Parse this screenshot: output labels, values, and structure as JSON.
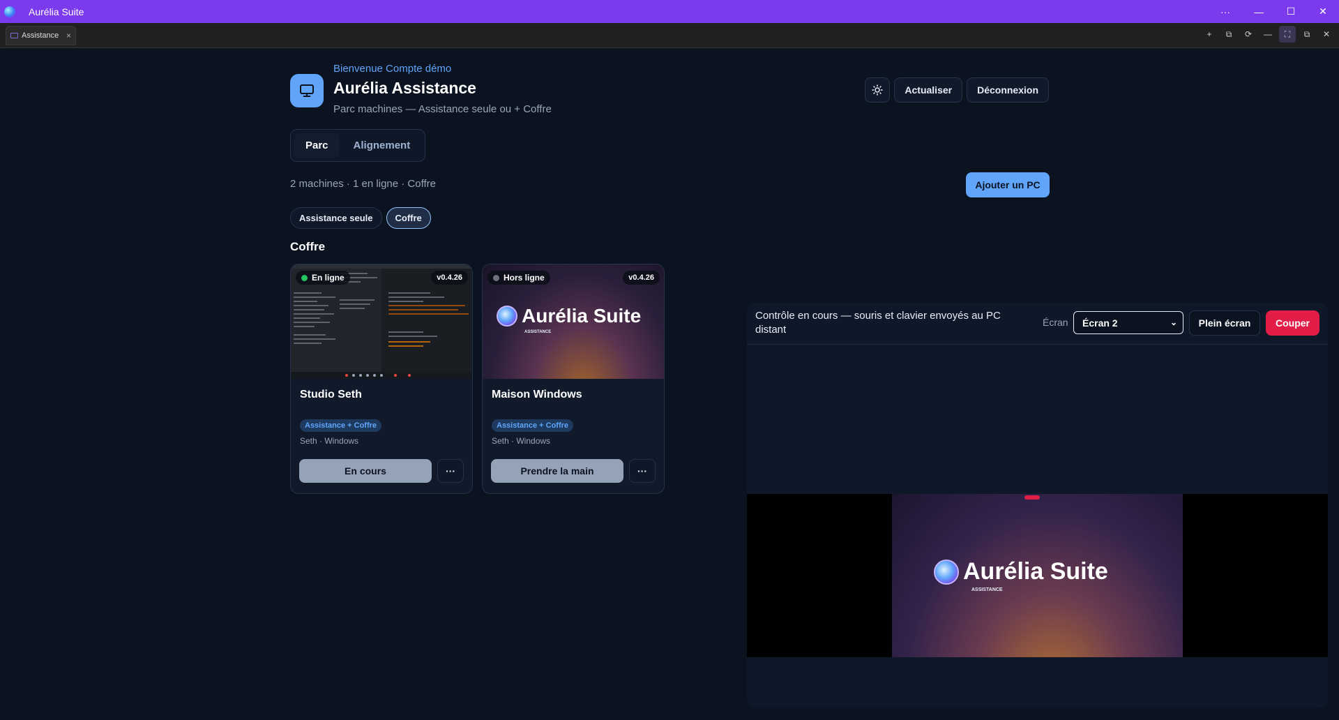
{
  "window": {
    "title": "Aurélia Suite",
    "controls": {
      "more": "···",
      "minimize": "—",
      "maximize": "☐",
      "close": "✕"
    }
  },
  "tabbar": {
    "tab_label": "Assistance",
    "tab_close": "×",
    "tools": [
      "+",
      "⧉",
      "⟳",
      "—",
      "⛶",
      "⧉",
      "✕"
    ]
  },
  "header": {
    "welcome": "Bienvenue Compte démo",
    "title": "Aurélia Assistance",
    "subtitle": "Parc machines — Assistance seule ou + Coffre",
    "refresh_label": "Actualiser",
    "logout_label": "Déconnexion",
    "theme_icon": "sun-icon"
  },
  "view_tabs": [
    {
      "label": "Parc",
      "active": true
    },
    {
      "label": "Alignement",
      "active": false
    }
  ],
  "summary": "2 machines · 1 en ligne · Coffre",
  "add_pc_label": "Ajouter un PC",
  "filters": [
    {
      "label": "Assistance seule",
      "active": false
    },
    {
      "label": "Coffre",
      "active": true
    }
  ],
  "section_title": "Coffre",
  "cards": [
    {
      "status": "En ligne",
      "online": true,
      "version": "v0.4.26",
      "name": "Studio Seth",
      "badge": "Assistance + Coffre",
      "meta": "Seth · Windows",
      "primary_label": "En cours",
      "more_label": "···"
    },
    {
      "status": "Hors ligne",
      "online": false,
      "version": "v0.4.26",
      "name": "Maison Windows",
      "badge": "Assistance + Coffre",
      "meta": "Seth · Windows",
      "primary_label": "Prendre la main",
      "more_label": "···",
      "thumb_brand": "Aurélia Suite",
      "thumb_brand_sub": "ASSISTANCE"
    }
  ],
  "remote": {
    "message": "Contrôle en cours — souris et clavier envoyés au PC distant",
    "screen_label": "Écran",
    "screen_value": "Écran 2",
    "fullscreen_label": "Plein écran",
    "cut_label": "Couper",
    "brand": "Aurélia Suite",
    "brand_sub": "ASSISTANCE"
  },
  "colors": {
    "accent": "#7c3aed",
    "primary": "#60a5fa",
    "danger": "#e11d48",
    "online": "#22c55e"
  }
}
